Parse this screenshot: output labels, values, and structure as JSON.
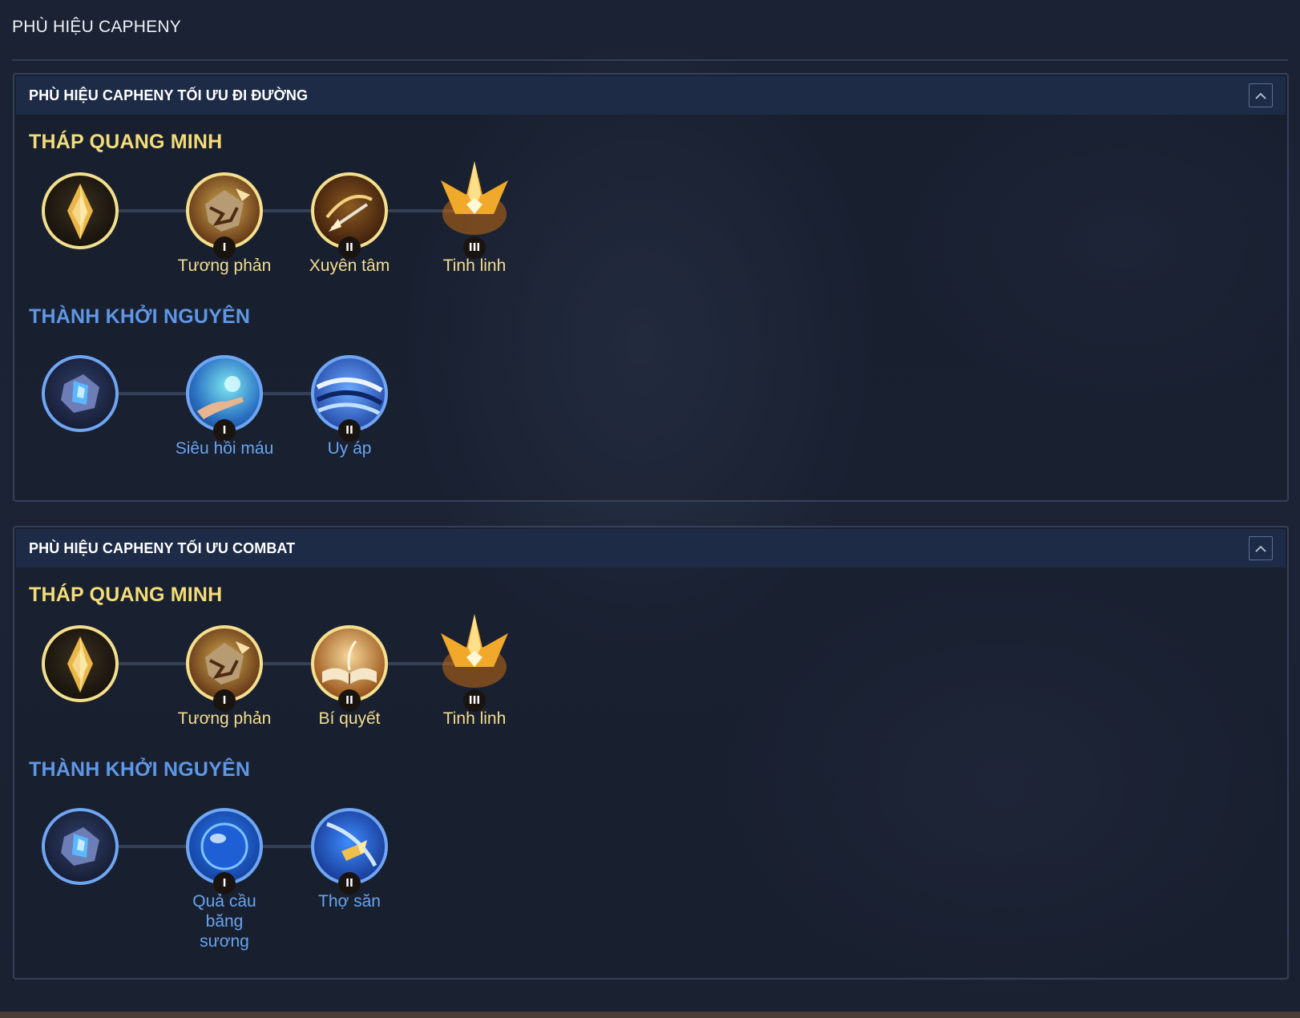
{
  "page_title": "PHÙ HIỆU CAPHENY",
  "panels": [
    {
      "title": "PHÙ HIỆU CAPHENY TỐI ƯU ĐI ĐƯỜNG",
      "collapse_icon": "chevron-up-icon",
      "gold_tree": {
        "title": "THÁP QUANG MINH",
        "runes": [
          {
            "label": "",
            "icon": "gold-crystal-icon"
          },
          {
            "label": "Tương phản",
            "tier": "I",
            "icon": "shattered-shield-icon"
          },
          {
            "label": "Xuyên tâm",
            "tier": "II",
            "icon": "arrow-icon"
          },
          {
            "label": "Tinh linh",
            "tier": "III",
            "icon": "golden-crown-icon"
          }
        ]
      },
      "blue_tree": {
        "title": "THÀNH KHỞI NGUYÊN",
        "runes": [
          {
            "label": "",
            "icon": "blue-crystal-icon"
          },
          {
            "label": "Siêu hồi máu",
            "tier": "I",
            "icon": "healing-hand-icon"
          },
          {
            "label": "Uy áp",
            "tier": "II",
            "icon": "wave-icon"
          }
        ]
      }
    },
    {
      "title": "PHÙ HIỆU CAPHENY TỐI ƯU COMBAT",
      "collapse_icon": "chevron-up-icon",
      "gold_tree": {
        "title": "THÁP QUANG MINH",
        "runes": [
          {
            "label": "",
            "icon": "gold-crystal-icon"
          },
          {
            "label": "Tương phản",
            "tier": "I",
            "icon": "shattered-shield-icon"
          },
          {
            "label": "Bí quyết",
            "tier": "II",
            "icon": "open-book-icon"
          },
          {
            "label": "Tinh linh",
            "tier": "III",
            "icon": "golden-crown-icon"
          }
        ]
      },
      "blue_tree": {
        "title": "THÀNH KHỞI NGUYÊN",
        "runes": [
          {
            "label": "",
            "icon": "blue-crystal-icon"
          },
          {
            "label": "Quả cầu băng sương",
            "tier": "I",
            "icon": "frost-orb-icon"
          },
          {
            "label": "Thợ săn",
            "tier": "II",
            "icon": "hunter-dart-icon"
          }
        ]
      }
    }
  ],
  "colors": {
    "gold_accent": "#f4dd78",
    "blue_accent": "#5f97e6",
    "header_bg": "#1d2b47",
    "page_bg": "#1a2233"
  }
}
